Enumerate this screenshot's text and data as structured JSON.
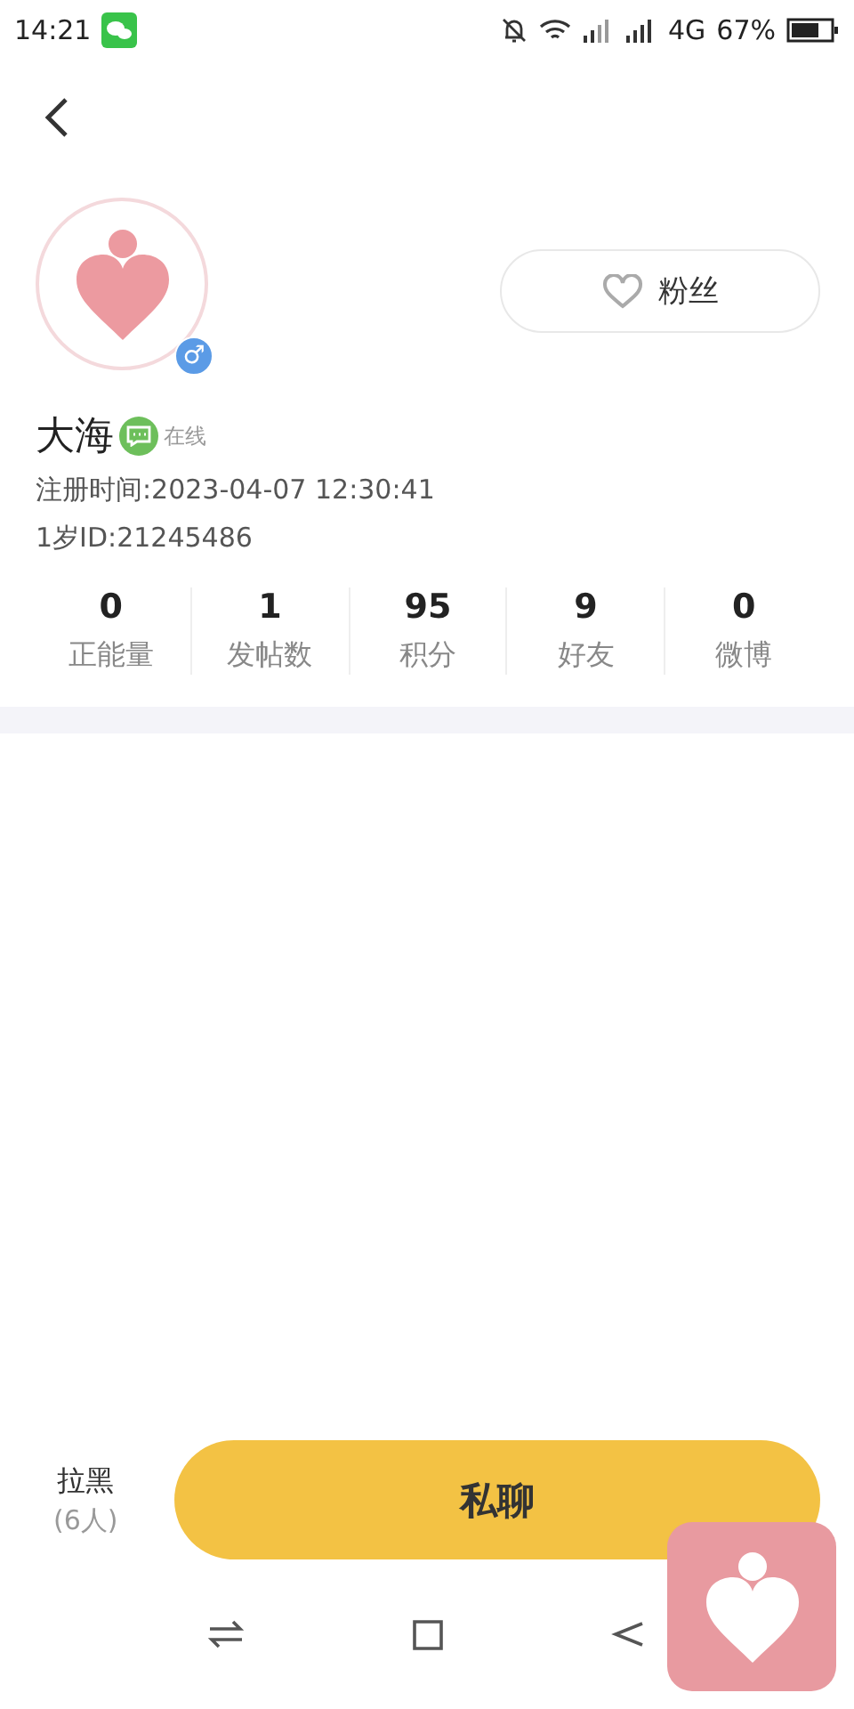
{
  "status_bar": {
    "time": "14:21",
    "network": "4G",
    "battery": "67%"
  },
  "profile": {
    "name": "大海",
    "online": true,
    "online_label": "在线",
    "gender_symbol": "♂",
    "registered": "注册时间:2023-04-07 12:30:41",
    "id_line": "1岁ID:21245486"
  },
  "fans_button": {
    "label": "粉丝"
  },
  "stats": [
    {
      "value": "0",
      "label": "正能量"
    },
    {
      "value": "1",
      "label": "发帖数"
    },
    {
      "value": "95",
      "label": "积分"
    },
    {
      "value": "9",
      "label": "好友"
    },
    {
      "value": "0",
      "label": "微博"
    }
  ],
  "bottom_bar": {
    "block_label": "拉黑",
    "block_count": "(6人)",
    "chat_button": "私聊"
  }
}
